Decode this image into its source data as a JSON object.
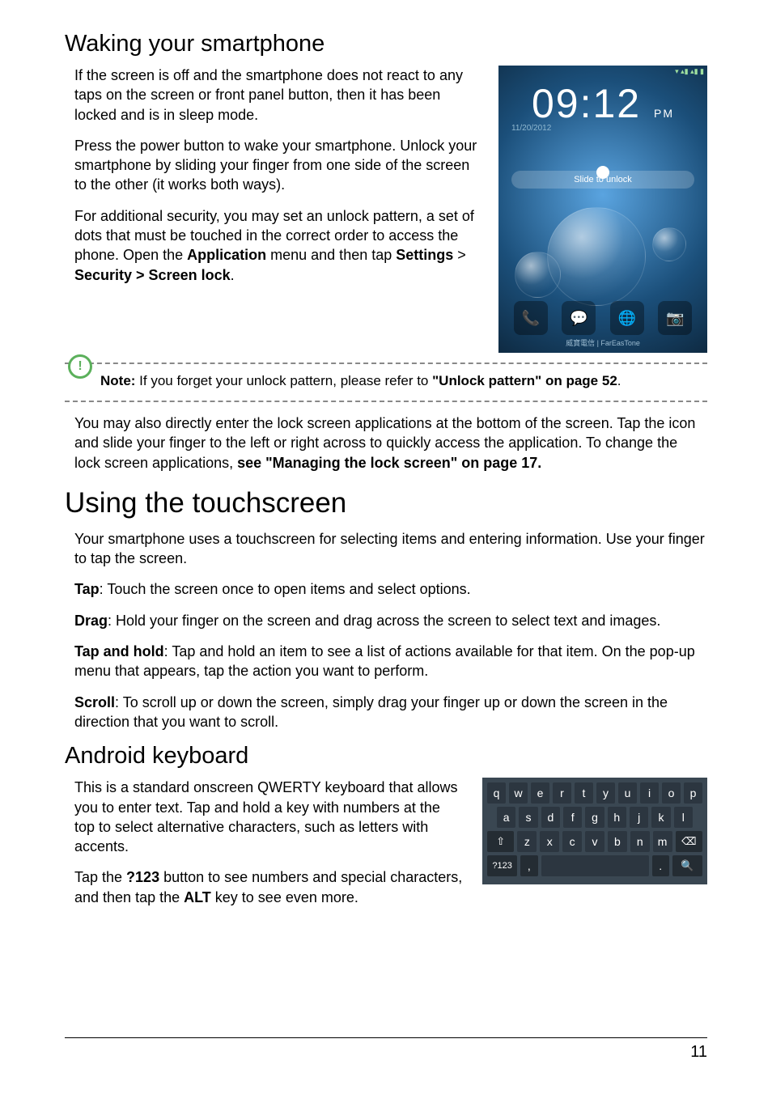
{
  "section1": {
    "title": "Waking your smartphone",
    "p1": "If the screen is off and the smartphone does not react to any taps on the screen or front panel button, then it has been locked and is in sleep mode.",
    "p2": "Press the power button to wake your smartphone. Unlock your smartphone by sliding your finger from one side of the screen to the other (it works both ways).",
    "p3_a": "For additional security, you may set an unlock pattern, a set of dots that must be touched in the correct order to access the phone. Open the ",
    "p3_app": "Application",
    "p3_b": " menu and then tap ",
    "p3_settings": "Settings",
    "p3_gt": " > ",
    "p3_sec": "Security > Screen lock",
    "p3_dot": "."
  },
  "lockscreen": {
    "status": "▾ ▴▮ ▴▮ ▮",
    "time": "09:12",
    "ampm": "PM",
    "date": "11/20/2012",
    "slide": "Slide to unlock",
    "carrier": "威寶電信  |  FarEasTone"
  },
  "note": {
    "label": "Note:",
    "a": " If you forget your unlock pattern, please refer to ",
    "ref": "\"Unlock pattern\" on page 52",
    "dot": "."
  },
  "post_note": {
    "a": "You may also directly enter the lock screen applications at the bottom of the screen. Tap the icon and slide your finger to the left or right across to quickly access the application. To change the lock screen applications, ",
    "b": "see \"Managing the lock screen\" on page 17."
  },
  "section2": {
    "title": "Using the touchscreen",
    "intro": "Your smartphone uses a touchscreen for selecting items and entering information. Use your finger to tap the screen.",
    "tap_l": "Tap",
    "tap": ": Touch the screen once to open items and select options.",
    "drag_l": "Drag",
    "drag": ": Hold your finger on the screen and drag across the screen to select text and images.",
    "th_l": "Tap and hold",
    "th": ": Tap and hold an item to see a list of actions available for that item. On the pop-up menu that appears, tap the action you want to perform.",
    "sc_l": "Scroll",
    "sc": ": To scroll up or down the screen, simply drag your finger up or down the screen in the direction that you want to scroll."
  },
  "section3": {
    "title": "Android keyboard",
    "p1": "This is a standard onscreen QWERTY keyboard that allows you to enter text. Tap and hold a key with numbers at the top to select alternative characters, such as letters with accents.",
    "p2_a": "Tap the ",
    "p2_b": "?123",
    "p2_c": " button to see numbers and special characters, and then tap the ",
    "p2_d": "ALT",
    "p2_e": " key to see even more."
  },
  "keyboard": {
    "row1": [
      "q",
      "w",
      "e",
      "r",
      "t",
      "y",
      "u",
      "i",
      "o",
      "p"
    ],
    "row2": [
      "a",
      "s",
      "d",
      "f",
      "g",
      "h",
      "j",
      "k",
      "l"
    ],
    "shift": "⇧",
    "row3": [
      "z",
      "x",
      "c",
      "v",
      "b",
      "n",
      "m"
    ],
    "back": "⌫",
    "n123": "?123",
    "comma": ",",
    "dot": ".",
    "search": "🔍"
  },
  "page_number": "11"
}
